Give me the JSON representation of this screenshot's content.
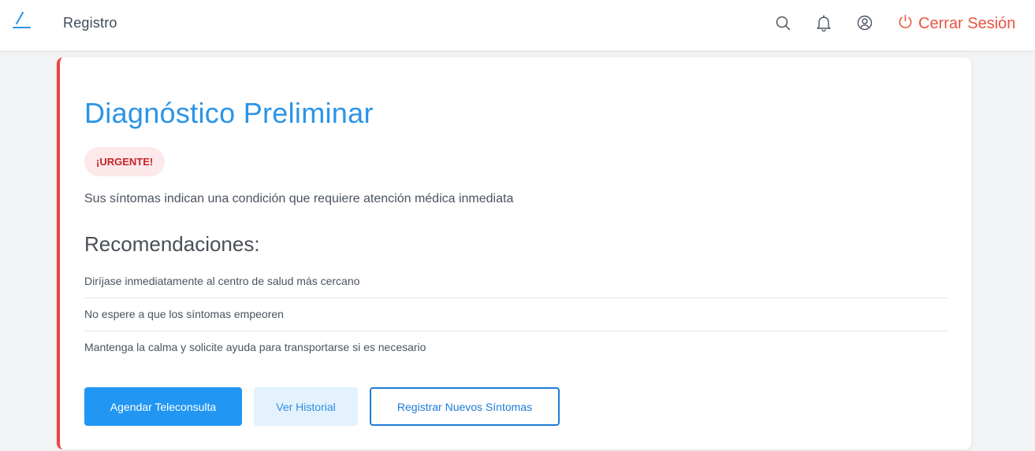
{
  "header": {
    "menu_icon": "pencil-line-icon",
    "brand": "Registro",
    "icons": [
      "search-icon",
      "bell-icon",
      "user-icon"
    ],
    "logout_label": "Cerrar Sesión",
    "logout_icon": "power-icon"
  },
  "card": {
    "title": "Diagnóstico Preliminar",
    "badge": "¡URGENTE!",
    "summary": "Sus síntomas indican una condición que requiere atención médica inmediata",
    "recommendations_heading": "Recomendaciones:",
    "recommendations": [
      "Diríjase inmediatamente al centro de salud más cercano",
      "No espere a que los síntomas empeoren",
      "Mantenga la calma y solicite ayuda para transportarse si es necesario"
    ],
    "buttons": {
      "schedule": "Agendar Teleconsulta",
      "history": "Ver Historial",
      "register": "Registrar Nuevos Síntomas"
    }
  },
  "colors": {
    "accent": "#2196f3",
    "urgent_border": "#ee4343",
    "logout": "#e9543f"
  }
}
